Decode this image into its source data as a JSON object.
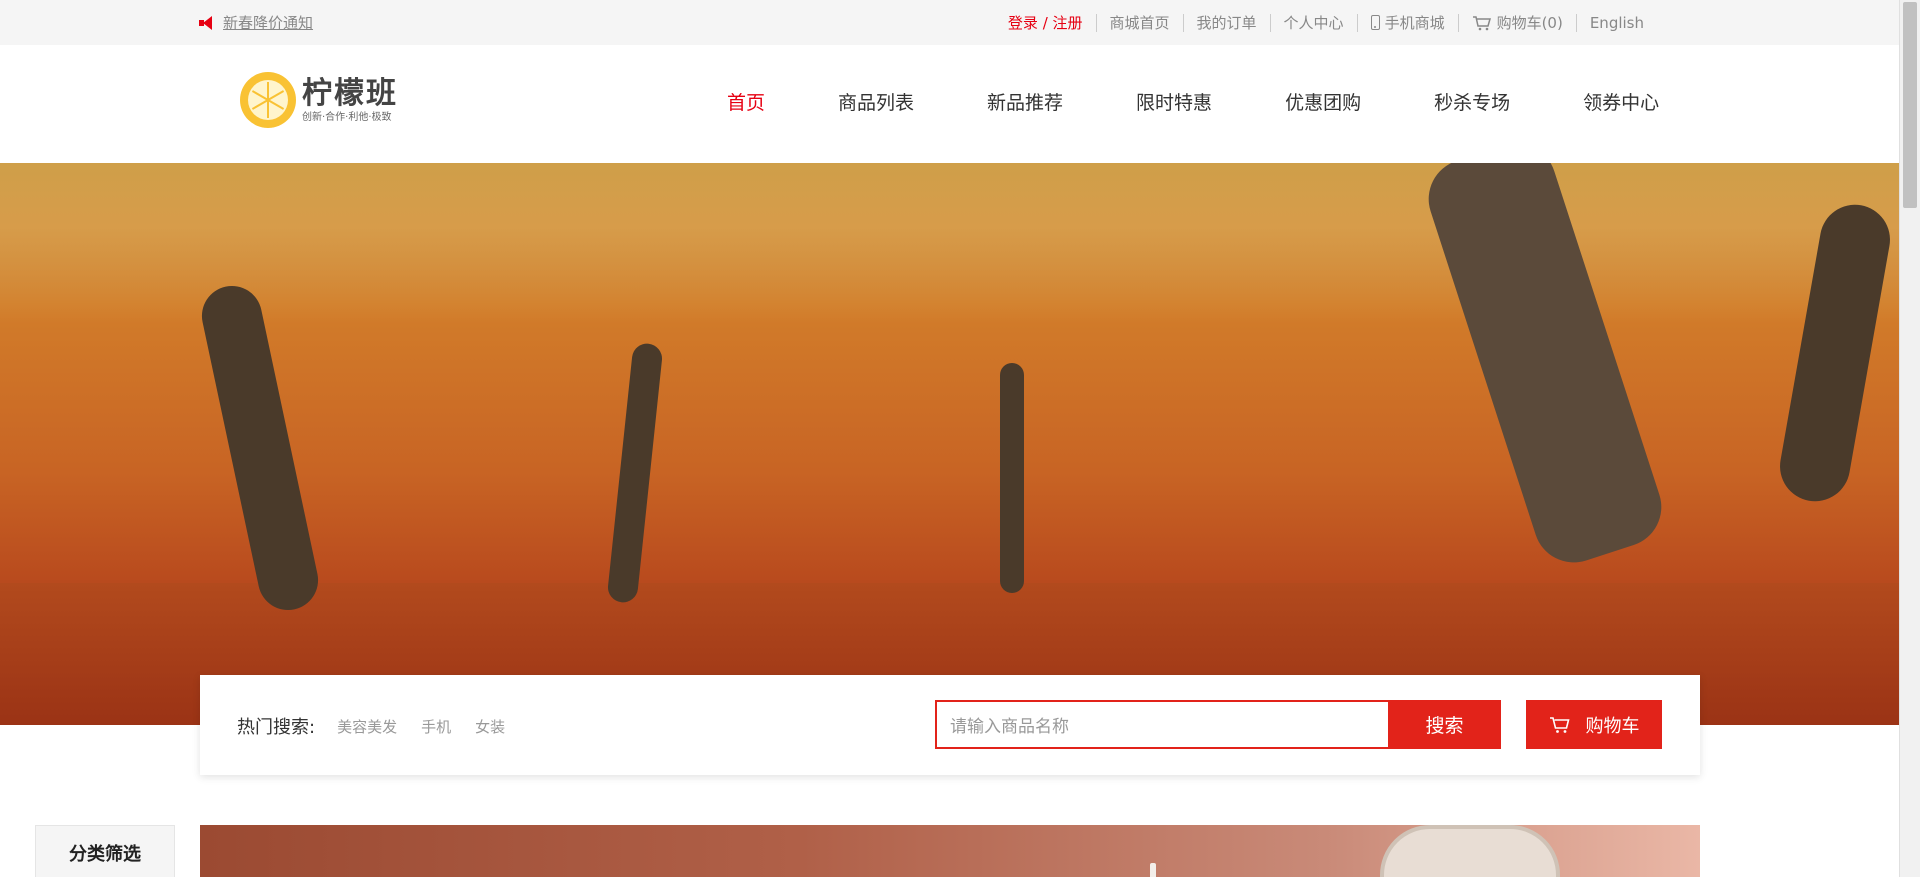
{
  "topbar": {
    "notice": "新春降价通知",
    "links": {
      "login": "登录 / 注册",
      "mall_home": "商城首页",
      "my_orders": "我的订单",
      "personal_center": "个人中心",
      "mobile_mall": "手机商城",
      "cart": "购物车(0)",
      "english": "English"
    }
  },
  "header": {
    "logo_name": "柠檬班",
    "logo_slogan": "创新·合作·利他·极致",
    "nav": [
      {
        "label": "首页",
        "active": true
      },
      {
        "label": "商品列表",
        "active": false
      },
      {
        "label": "新品推荐",
        "active": false
      },
      {
        "label": "限时特惠",
        "active": false
      },
      {
        "label": "优惠团购",
        "active": false
      },
      {
        "label": "秒杀专场",
        "active": false
      },
      {
        "label": "领券中心",
        "active": false
      }
    ]
  },
  "search": {
    "hot_label": "热门搜索:",
    "hot_terms": [
      "美容美发",
      "手机",
      "女装"
    ],
    "placeholder": "请输入商品名称",
    "search_button": "搜索",
    "cart_button": "购物车"
  },
  "sidebar": {
    "filter_title": "分类筛选"
  },
  "colors": {
    "accent": "#e2231a",
    "topbar_bg": "#f5f5f5",
    "logo_yellow": "#f9c233"
  },
  "icons": {
    "notice": "speaker-icon",
    "mobile": "phone-icon",
    "cart": "cart-icon"
  }
}
